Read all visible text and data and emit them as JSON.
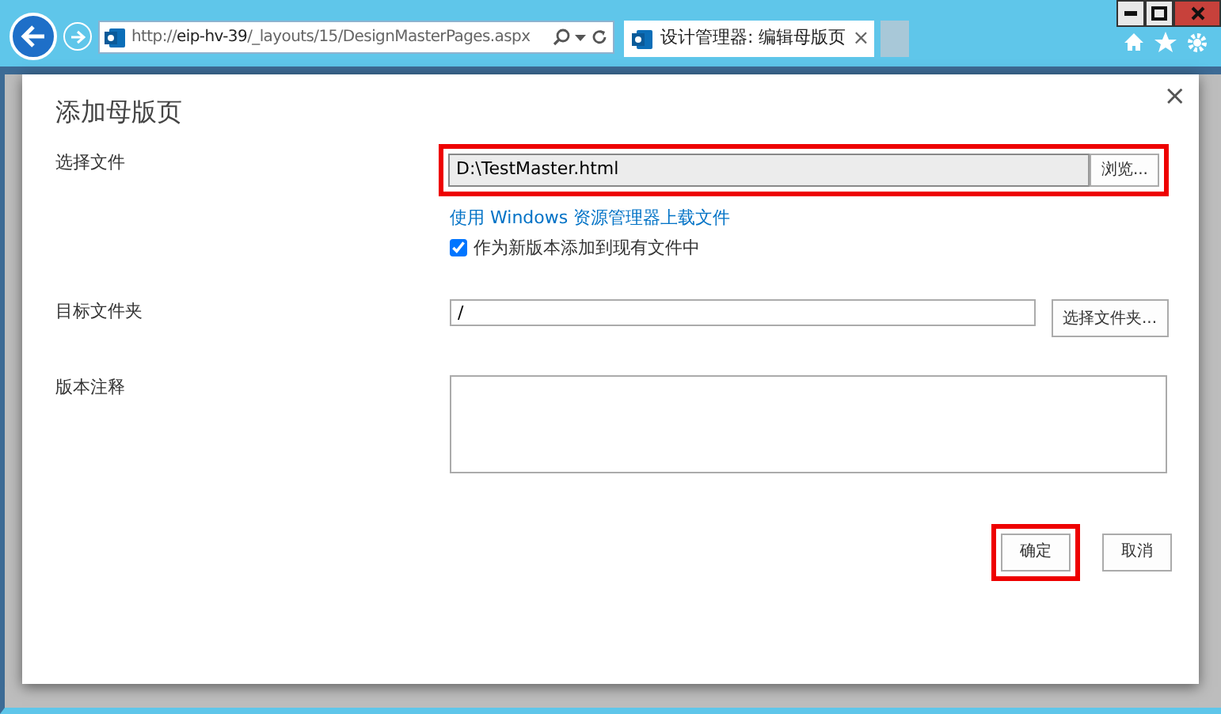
{
  "browser": {
    "address": "http://**eip-hv-39**/_layouts/15/DesignMasterPages.aspx",
    "tab_title": "设计管理器: 编辑母版页",
    "tab_close": "×"
  },
  "dialog": {
    "title": "添加母版页",
    "close": "×",
    "fields": [
      {
        "kind": "file",
        "label": "选择文件",
        "value": "D:\\TestMaster.html",
        "button": "浏览...",
        "highlighted": true,
        "link": "使用 Windows 资源管理器上载文件",
        "checkbox": {
          "label": "作为新版本添加到现有文件中",
          "checked": true
        }
      },
      {
        "kind": "text",
        "label": "目标文件夹",
        "value": "/",
        "button": "选择文件夹..."
      },
      {
        "kind": "textarea",
        "label": "版本注释"
      }
    ],
    "buttons": [
      {
        "label": "确定",
        "highlighted": true
      },
      {
        "label": "取消",
        "highlighted": false
      }
    ]
  }
}
